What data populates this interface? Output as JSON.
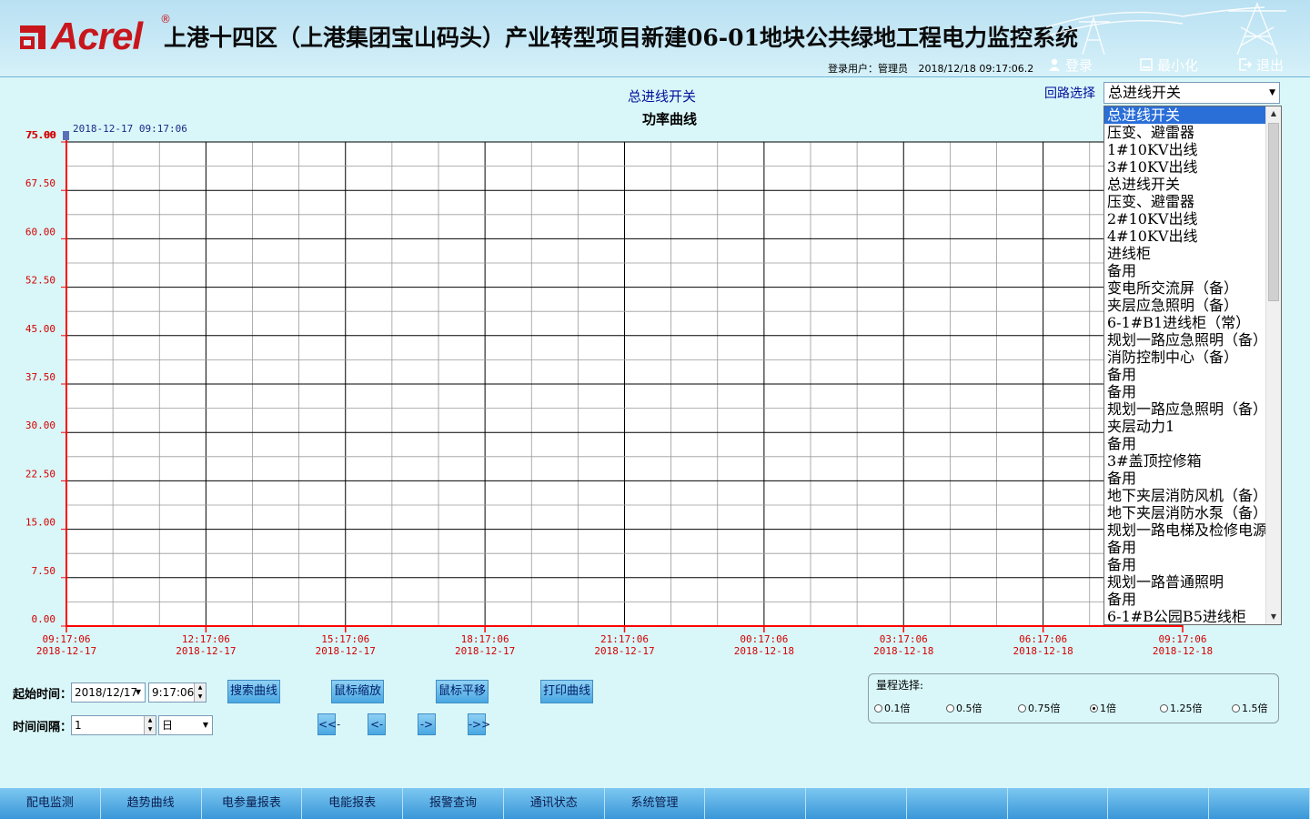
{
  "header": {
    "logo_text": "Acrel",
    "logo_reg": "®",
    "title": "上港十四区（上港集团宝山码头）产业转型项目新建06-01地块公共绿地工程电力监控系统",
    "user_label": "登录用户：管理员",
    "datetime": "2018/12/18  09:17:06.2",
    "login_label": "登录",
    "minimize_label": "最小化",
    "logout_label": "退出"
  },
  "chart_header": {
    "subtitle": "总进线开关",
    "title": "功率曲线",
    "cursor_time": "2018-12-17  09:17:06"
  },
  "chart_data": {
    "type": "line",
    "title": "功率曲线",
    "ylim": [
      0,
      75
    ],
    "y_ticks": [
      "0.00",
      "7.50",
      "15.00",
      "22.50",
      "30.00",
      "37.50",
      "45.00",
      "52.50",
      "60.00",
      "67.50",
      "75.00"
    ],
    "y_top_label": "75.00",
    "x_ticks": [
      {
        "time": "09:17:06",
        "date": "2018-12-17"
      },
      {
        "time": "12:17:06",
        "date": "2018-12-17"
      },
      {
        "time": "15:17:06",
        "date": "2018-12-17"
      },
      {
        "time": "18:17:06",
        "date": "2018-12-17"
      },
      {
        "time": "21:17:06",
        "date": "2018-12-17"
      },
      {
        "time": "00:17:06",
        "date": "2018-12-18"
      },
      {
        "time": "03:17:06",
        "date": "2018-12-18"
      },
      {
        "time": "06:17:06",
        "date": "2018-12-18"
      },
      {
        "time": "09:17:06",
        "date": "2018-12-18"
      }
    ],
    "series": [],
    "grid": true,
    "colors": {
      "axis": "#ff0000",
      "major_grid": "#000000",
      "minor_grid": "#9a9a9a",
      "plot_bg": "#ffffff",
      "tick_label": "#d40000"
    }
  },
  "circuit": {
    "label": "回路选择",
    "selected": "总进线开关",
    "options": [
      "总进线开关",
      "压变、避雷器",
      "1#10KV出线",
      "3#10KV出线",
      "总进线开关",
      "压变、避雷器",
      "2#10KV出线",
      "4#10KV出线",
      "进线柜",
      "备用",
      "变电所交流屏（备）",
      "夹层应急照明（备）",
      "6-1#B1进线柜（常）",
      "规划一路应急照明（备）",
      "消防控制中心（备）",
      "备用",
      "备用",
      "规划一路应急照明（备）",
      "夹层动力1",
      "备用",
      "3#盖顶控修箱",
      "备用",
      "地下夹层消防风机（备）",
      "地下夹层消防水泵（备）",
      "规划一路电梯及检修电源",
      "备用",
      "备用",
      "规划一路普通照明",
      "备用",
      "6-1#B公园B5进线柜"
    ]
  },
  "controls": {
    "start_label": "起始时间：",
    "start_date": "2018/12/17",
    "start_time": "9:17:06",
    "interval_label": "时间间隔：",
    "interval_value": "1",
    "interval_unit": "日",
    "search_curve": "搜索曲线",
    "mouse_zoom": "鼠标缩放",
    "mouse_pan": "鼠标平移",
    "print_curve": "打印曲线",
    "first": "<<-",
    "prev": "<-",
    "next": "->",
    "last": "->>"
  },
  "range": {
    "label": "量程选择:",
    "options": [
      "0.1倍",
      "0.5倍",
      "0.75倍",
      "1倍",
      "1.25倍",
      "1.5倍"
    ],
    "selected": "1倍"
  },
  "nav": {
    "tabs": [
      "配电监测",
      "趋势曲线",
      "电参量报表",
      "电能报表",
      "报警查询",
      "通讯状态",
      "系统管理",
      "",
      "",
      "",
      "",
      "",
      ""
    ]
  }
}
